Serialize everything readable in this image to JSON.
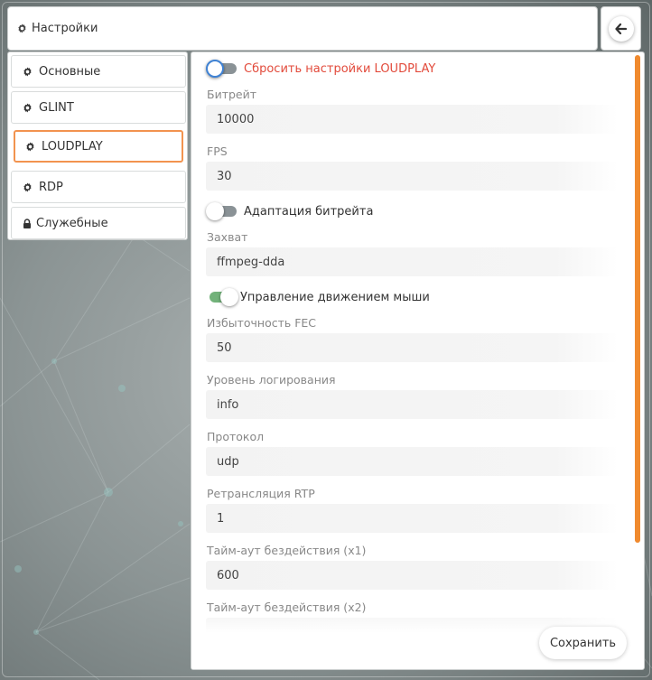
{
  "header": {
    "title": "Настройки",
    "icon": "gear-icon",
    "back_icon": "arrow-left-icon"
  },
  "sidebar": {
    "items": [
      {
        "label": "Основные",
        "icon": "gear-icon",
        "active": false
      },
      {
        "label": "GLINT",
        "icon": "gear-icon",
        "active": false
      },
      {
        "label": "LOUDPLAY",
        "icon": "gear-icon",
        "active": true
      },
      {
        "label": "RDP",
        "icon": "gear-icon",
        "active": false
      },
      {
        "label": "Служебные",
        "icon": "lock-icon",
        "active": false
      }
    ]
  },
  "settings": {
    "reset": {
      "label": "Сбросить настройки LOUDPLAY",
      "on": false
    },
    "bitrate": {
      "label": "Битрейт",
      "value": "10000"
    },
    "fps": {
      "label": "FPS",
      "value": "30"
    },
    "bitrate_adaptation": {
      "label": "Адаптация битрейта",
      "on": false
    },
    "capture": {
      "label": "Захват",
      "value": "ffmpeg-dda"
    },
    "mouse_control": {
      "label": "Управление движением мыши",
      "on": true
    },
    "fec": {
      "label": "Избыточность FEC",
      "value": "50"
    },
    "log_level": {
      "label": "Уровень логирования",
      "value": "info"
    },
    "protocol": {
      "label": "Протокол",
      "value": "udp"
    },
    "rtp": {
      "label": "Ретрансляция RTP",
      "value": "1"
    },
    "timeout1": {
      "label": "Тайм-аут бездействия (x1)",
      "value": "600"
    },
    "timeout2": {
      "label": "Тайм-аут бездействия (x2)"
    }
  },
  "save_label": "Сохранить",
  "colors": {
    "accent": "#f08a2e",
    "active_border": "#f2934f",
    "danger_text": "#e24a3b",
    "toggle_on": "#72b27a",
    "toggle_off": "#8a9296"
  }
}
